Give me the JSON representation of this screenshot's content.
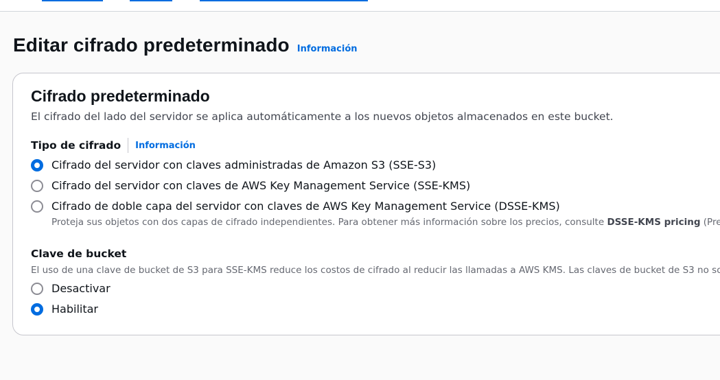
{
  "page": {
    "title": "Editar cifrado predeterminado",
    "info_label": "Información"
  },
  "container": {
    "title": "Cifrado predeterminado",
    "description": "El cifrado del lado del servidor se aplica automáticamente a los nuevos objetos almacenados en este bucket."
  },
  "encryption_type": {
    "label": "Tipo de cifrado",
    "info_label": "Información",
    "options": [
      {
        "label": "Cifrado del servidor con claves administradas de Amazon S3 (SSE-S3)",
        "selected": true
      },
      {
        "label": "Cifrado del servidor con claves de AWS Key Management Service (SSE-KMS)",
        "selected": false
      },
      {
        "label": "Cifrado de doble capa del servidor con claves de AWS Key Management Service (DSSE-KMS)",
        "selected": false
      }
    ],
    "dsse_help_prefix": "Proteja sus objetos con dos capas de cifrado independientes. Para obtener más información sobre los precios, consulte ",
    "dsse_help_bold": "DSSE-KMS pricing",
    "dsse_help_suffix": " (Pre"
  },
  "bucket_key": {
    "label": "Clave de bucket",
    "description": "El uso de una clave de bucket de S3 para SSE-KMS reduce los costos de cifrado al reducir las llamadas a AWS KMS. Las claves de bucket de S3 no so",
    "options": [
      {
        "label": "Desactivar",
        "selected": false
      },
      {
        "label": "Habilitar",
        "selected": true
      }
    ]
  },
  "colors": {
    "accent": "#006ce0",
    "text": "#0f141a",
    "secondary_text": "#656871",
    "border": "#c6c6cd"
  }
}
